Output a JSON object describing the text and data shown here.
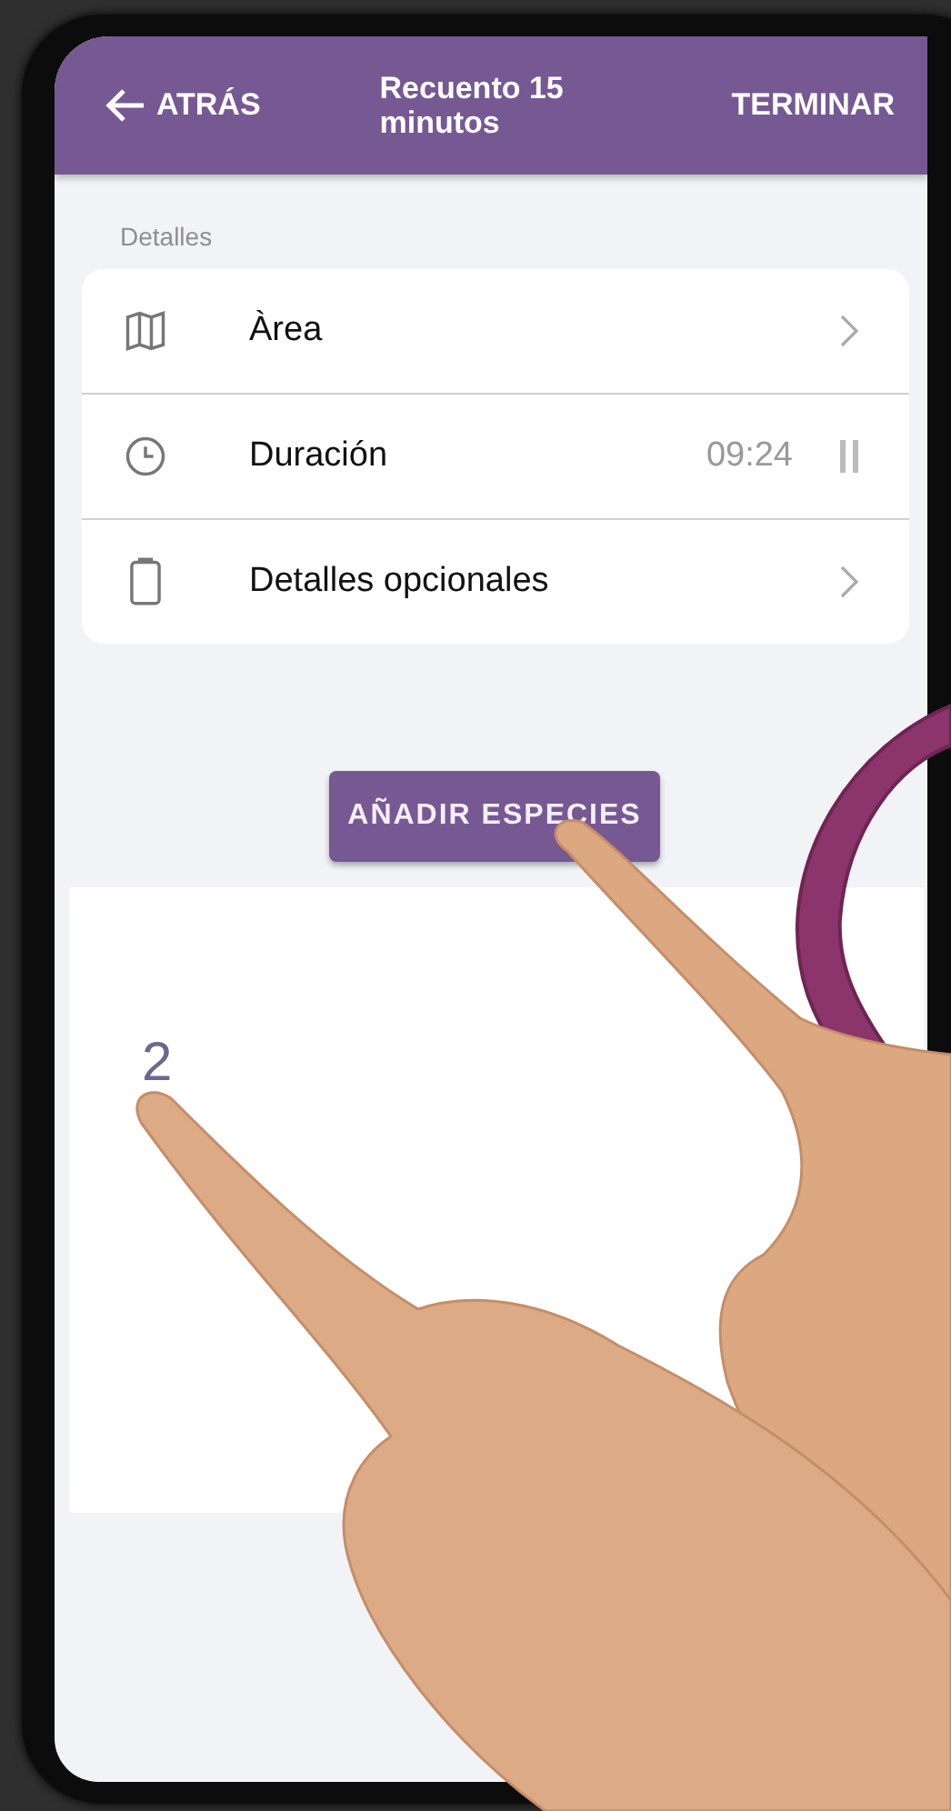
{
  "header": {
    "back": "ATRÁS",
    "title": "Recuento 15 minutos",
    "action": "TERMINAR"
  },
  "section_label": "Detalles",
  "details": [
    {
      "kind": "map",
      "label": "Àrea",
      "chevron": true
    },
    {
      "kind": "clock",
      "label": "Duración",
      "value": "09:24",
      "chevron": false,
      "timer_running": true
    },
    {
      "kind": "clipboard",
      "label": "Detalles opcionales",
      "chevron": true
    }
  ],
  "add_button": "AÑADIR ESPECIES",
  "species_panel": {
    "count": "2"
  }
}
